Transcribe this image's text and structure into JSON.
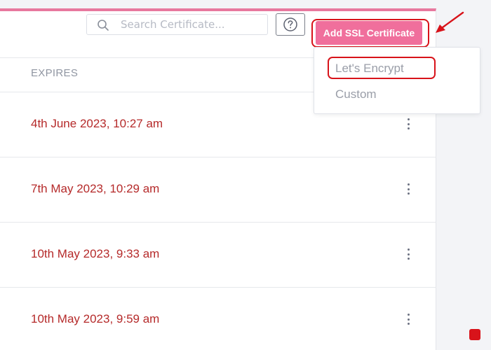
{
  "search": {
    "placeholder": "Search Certificate..."
  },
  "toolbar": {
    "add_label": "Add SSL Certificate"
  },
  "table": {
    "column_expires": "EXPIRES",
    "rows": [
      {
        "expires": "4th June 2023, 10:27 am"
      },
      {
        "expires": "7th May 2023, 10:29 am"
      },
      {
        "expires": "10th May 2023, 9:33 am"
      },
      {
        "expires": "10th May 2023, 9:59 am"
      }
    ]
  },
  "dropdown": {
    "options": [
      {
        "label": "Let's Encrypt"
      },
      {
        "label": "Custom"
      }
    ]
  },
  "colors": {
    "accent": "#f06f9c",
    "date_text": "#b52a2a",
    "annotation": "#d8131a"
  }
}
